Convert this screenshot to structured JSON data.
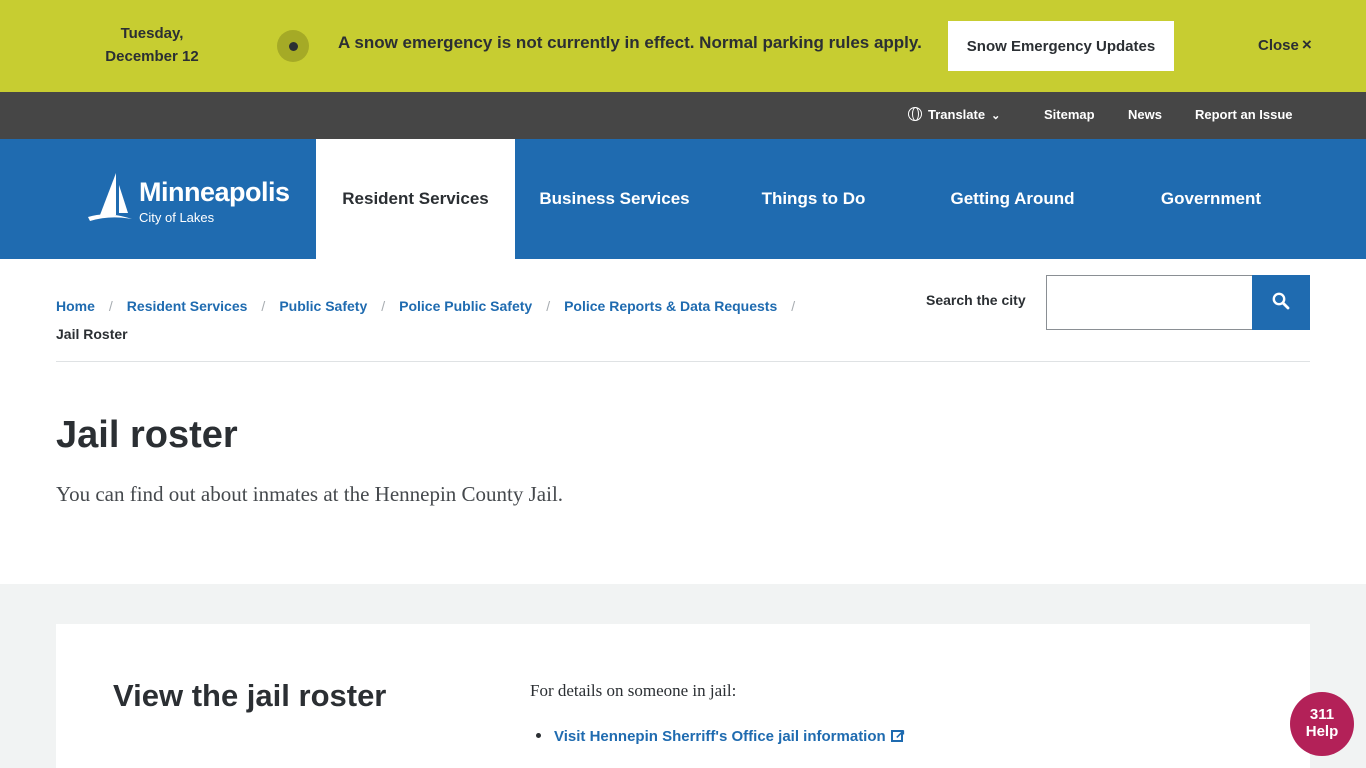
{
  "banner": {
    "date_line1": "Tuesday,",
    "date_line2": "December 12",
    "message": "A snow emergency is not currently in effect. Normal parking rules apply.",
    "updates_button": "Snow Emergency Updates",
    "close_label": "Close",
    "close_icon": "×"
  },
  "utility": {
    "translate": "Translate",
    "sitemap": "Sitemap",
    "news": "News",
    "report": "Report an Issue"
  },
  "logo": {
    "title": "Minneapolis",
    "subtitle": "City of Lakes"
  },
  "nav": {
    "items": [
      {
        "label": "Resident Services"
      },
      {
        "label": "Business Services"
      },
      {
        "label": "Things to Do"
      },
      {
        "label": "Getting Around"
      },
      {
        "label": "Government"
      }
    ]
  },
  "breadcrumb": {
    "items": [
      "Home",
      "Resident Services",
      "Public Safety",
      "Police Public Safety",
      "Police Reports & Data Requests"
    ],
    "current": "Jail Roster"
  },
  "search": {
    "label": "Search the city",
    "value": "",
    "placeholder": ""
  },
  "page": {
    "title": "Jail roster",
    "lede": "You can find out about inmates at the Hennepin County Jail."
  },
  "card": {
    "title": "View the jail roster",
    "intro": "For details on someone in jail:",
    "links": [
      "Visit Hennepin Sherriff's Office jail information"
    ]
  },
  "help": {
    "line1": "311",
    "line2": "Help"
  },
  "colors": {
    "banner_bg": "#c7cd31",
    "utility_bg": "#464646",
    "nav_bg": "#1f6bb0",
    "help_bg": "#b32158"
  }
}
